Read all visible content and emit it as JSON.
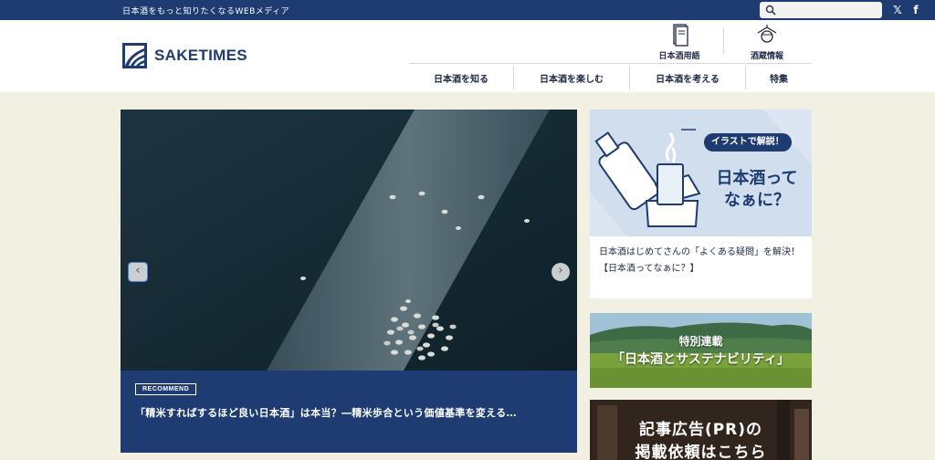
{
  "topbar": {
    "tagline": "日本酒をもっと知りたくなるWEBメディア",
    "search_placeholder": "",
    "social": [
      {
        "name": "x",
        "icon": "x-logo-icon",
        "glyph": "𝕏"
      },
      {
        "name": "facebook",
        "icon": "facebook-icon",
        "glyph": "f"
      }
    ]
  },
  "header": {
    "logo_text": "SAKETIMES",
    "util_links": [
      {
        "label": "日本酒用語",
        "icon": "book-icon"
      },
      {
        "label": "酒蔵情報",
        "icon": "brewery-icon"
      }
    ]
  },
  "nav": {
    "items": [
      {
        "label": "日本酒を知る"
      },
      {
        "label": "日本酒を楽しむ"
      },
      {
        "label": "日本酒を考える"
      },
      {
        "label": "特集"
      }
    ]
  },
  "hero": {
    "badge": "RECOMMEND",
    "headline": "「精米すればするほど良い日本酒」は本当？―精米歩合という価値基準を変える…",
    "prev_glyph": "‹",
    "next_glyph": "›"
  },
  "side": {
    "card": {
      "bubble": "イラストで解説！",
      "big_line1": "日本酒って",
      "big_line2": "なぁに？",
      "caption": "日本酒はじめてさんの「よくある疑問」を解決！【日本酒ってなぁに？】"
    },
    "sustain": {
      "kicker": "特別連載",
      "title": "「日本酒とサステナビリティ」"
    },
    "ad": {
      "line1": "記事広告(PR)の",
      "line2": "掲載依頼はこちら"
    }
  },
  "colors": {
    "brand_navy": "#1e3c72",
    "background": "#f2efe3"
  }
}
